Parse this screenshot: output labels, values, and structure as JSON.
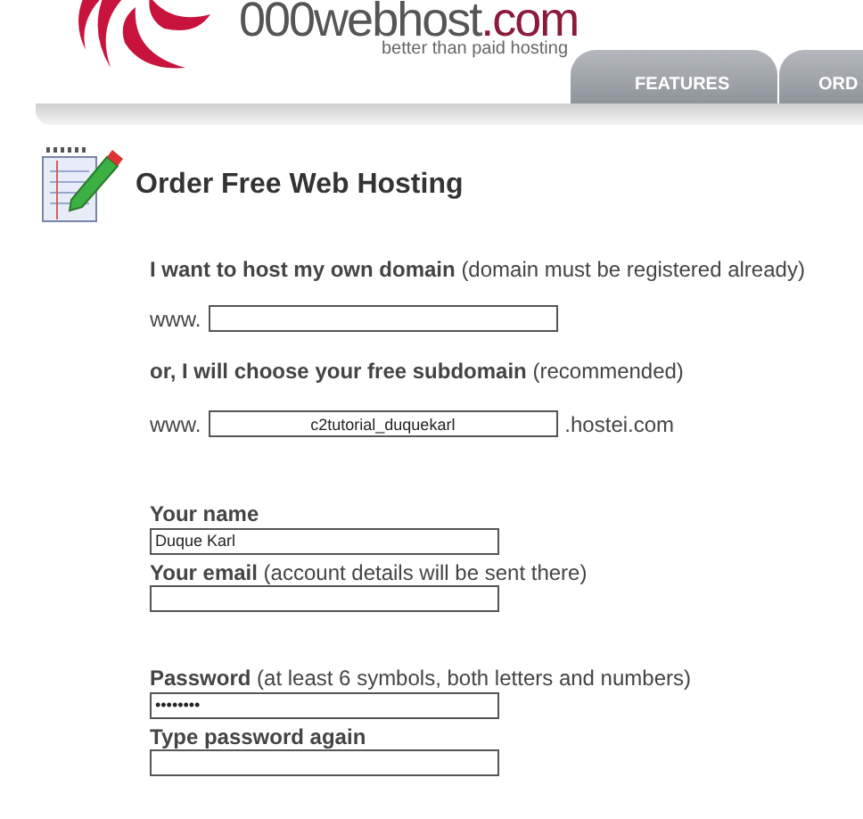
{
  "header": {
    "logo": {
      "name": "000webhost",
      "tld": ".com",
      "tagline": "better than paid hosting"
    },
    "tabs": [
      {
        "label": "FEATURES",
        "selected": false
      },
      {
        "label": "ORD",
        "selected": false
      }
    ]
  },
  "page_title": "Order Free Web Hosting",
  "domain": {
    "own_label": {
      "bold": "I want to host my own domain",
      "note": "(domain must be registered already)"
    },
    "own_prefix": "www.",
    "sub_label": {
      "bold": "or, I will choose your free subdomain",
      "note": "(recommended)"
    },
    "sub_prefix": "www.",
    "sub_value": "c2tutorial_duquekarl",
    "sub_suffix": ".hostei.com"
  },
  "field_groups": [
    [
      {
        "label": "Your name",
        "value": "Duque Karl"
      },
      {
        "label": "Your email",
        "note": "(account details will be sent there)"
      }
    ],
    [
      {
        "label": "Password",
        "note": "(at least 6 symbols, both letters and numbers)",
        "value": "••••••••"
      },
      {
        "label": "Type password again"
      }
    ]
  ]
}
